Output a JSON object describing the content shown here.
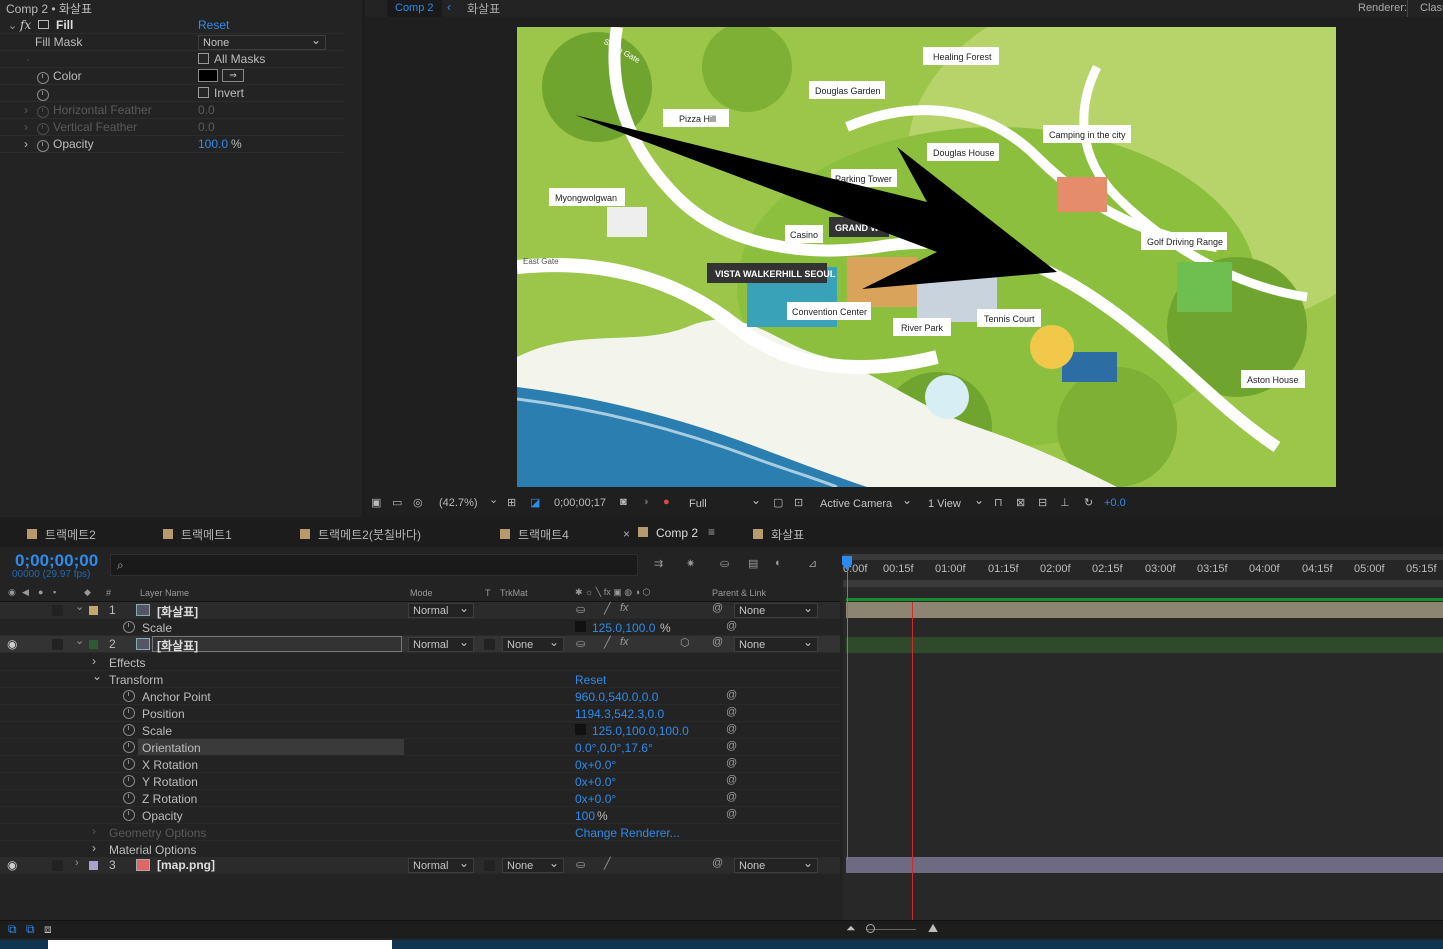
{
  "effects_panel": {
    "header": "Comp 2 • 화살표",
    "effect_name": "Fill",
    "reset": "Reset",
    "props": [
      {
        "name": "Fill Mask",
        "value": "None"
      },
      {
        "name": "",
        "value": "All Masks"
      },
      {
        "name": "Color",
        "value": ""
      },
      {
        "name": "",
        "value": "Invert"
      },
      {
        "name": "Horizontal Feather",
        "value": "0.0"
      },
      {
        "name": "Vertical Feather",
        "value": "0.0"
      },
      {
        "name": "Opacity",
        "value": "100.0",
        "unit": "%"
      }
    ]
  },
  "viewer": {
    "tab_active": "Comp 2",
    "breadcrumb": "화살표",
    "renderer_label": "Renderer:",
    "renderer_value": "Class",
    "map_labels": {
      "south_gate": "South Gate",
      "healing_forest": "Healing Forest",
      "douglas_garden": "Douglas Garden",
      "pizza_hill": "Pizza Hill",
      "camping": "Camping in the city",
      "douglas_house": "Douglas House",
      "parking_tower": "Parking Tower",
      "myongwolgwan": "Myongwolgwan",
      "casino": "Casino",
      "grand": "GRAND W",
      "golf": "Golf Driving Range",
      "east_gate": "East Gate",
      "vista": "VISTA WALKERHILL SEOUL",
      "convention": "Convention Center",
      "river_park": "River Park",
      "tennis": "Tennis Court",
      "aston": "Aston House"
    },
    "toolbar": {
      "zoom": "(42.7%)",
      "timecode": "0;00;00;17",
      "resolution": "Full",
      "camera": "Active Camera",
      "views": "1 View",
      "exposure": "+0.0"
    }
  },
  "timeline": {
    "tabs": [
      "트랙메트2",
      "트랙메트1",
      "트랙메트2(붓칠바다)",
      "트랙매트4",
      "Comp 2",
      "화살표"
    ],
    "tab_colors": [
      "#b79a6e",
      "#b79a6e",
      "#b79a6e",
      "#b79a6e",
      "#b79a6e",
      "#b79a6e"
    ],
    "timecode": "0;00;00;00",
    "fps": "00000 (29.97 fps)",
    "search_placeholder": "",
    "col_layer_name": "Layer Name",
    "col_mode": "Mode",
    "col_t": "T",
    "col_trkmat": "TrkMat",
    "col_parent": "Parent & Link",
    "ruler": [
      "0:00f",
      "00:15f",
      "01:00f",
      "01:15f",
      "02:00f",
      "02:15f",
      "03:00f",
      "03:15f",
      "04:00f",
      "04:15f",
      "05:00f",
      "05:15f"
    ],
    "layer1": {
      "num": "1",
      "name": "[화살표]",
      "mode": "Normal",
      "parent": "None",
      "scale_label": "Scale",
      "scale_value": "125.0,100.0",
      "scale_unit": "%"
    },
    "layer2": {
      "num": "2",
      "name": "[화살표]",
      "mode": "Normal",
      "trkmat": "None",
      "parent": "None"
    },
    "layer2_props": {
      "effects": "Effects",
      "transform": "Transform",
      "reset": "Reset",
      "rows": [
        {
          "label": "Anchor Point",
          "value": "960.0,540.0,0.0"
        },
        {
          "label": "Position",
          "value": "1194.3,542.3,0.0"
        },
        {
          "label": "Scale",
          "value": "125.0,100.0,100.0"
        },
        {
          "label": "Orientation",
          "value": "0.0°,0.0°,17.6°"
        },
        {
          "label": "X Rotation",
          "value": "0x+0.0°"
        },
        {
          "label": "Y Rotation",
          "value": "0x+0.0°"
        },
        {
          "label": "Z Rotation",
          "value": "0x+0.0°"
        },
        {
          "label": "Opacity",
          "value": "100",
          "unit": "%"
        }
      ],
      "geometry": "Geometry Options",
      "change_renderer": "Change Renderer...",
      "material": "Material Options"
    },
    "layer3": {
      "num": "3",
      "name": "[map.png]",
      "mode": "Normal",
      "trkmat": "None",
      "parent": "None"
    }
  }
}
